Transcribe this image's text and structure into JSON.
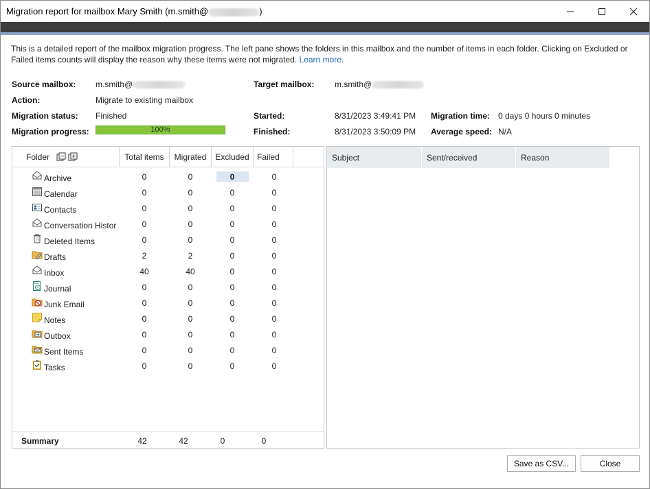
{
  "window": {
    "title_prefix": "Migration report for mailbox Mary Smith (m.smith@",
    "title_suffix": ")"
  },
  "description": {
    "text": "This is a detailed report of the mailbox migration progress. The left pane shows the folders in this mailbox and the number of items in each folder. Clicking on Excluded or Failed items counts will display the reason why these items were not migrated. ",
    "link": "Learn more."
  },
  "info": {
    "source_label": "Source mailbox:",
    "source_value": "m.smith@",
    "target_label": "Target mailbox:",
    "target_value": "m.smith@",
    "action_label": "Action:",
    "action_value": "Migrate to existing mailbox",
    "status_label": "Migration status:",
    "status_value": "Finished",
    "progress_label": "Migration progress:",
    "progress_text": "100%",
    "progress_value": 100,
    "started_label": "Started:",
    "started_value": "8/31/2023 3:49:41 PM",
    "finished_label": "Finished:",
    "finished_value": "8/31/2023 3:50:09 PM",
    "time_label": "Migration time:",
    "time_value": "0 days 0 hours 0 minutes",
    "speed_label": "Average speed:",
    "speed_value": "N/A"
  },
  "table": {
    "columns": [
      "Folder",
      "Total items",
      "Migrated",
      "Excluded",
      "Failed"
    ],
    "rows": [
      {
        "name": "Archive",
        "icon": "envelope-icon",
        "total": "0",
        "migrated": "0",
        "excluded": "0",
        "failed": "0"
      },
      {
        "name": "Calendar",
        "icon": "calendar-icon",
        "total": "0",
        "migrated": "0",
        "excluded": "0",
        "failed": "0"
      },
      {
        "name": "Contacts",
        "icon": "contact-card-icon",
        "total": "0",
        "migrated": "0",
        "excluded": "0",
        "failed": "0"
      },
      {
        "name": "Conversation Histor",
        "icon": "envelope-icon",
        "total": "0",
        "migrated": "0",
        "excluded": "0",
        "failed": "0"
      },
      {
        "name": "Deleted Items",
        "icon": "trash-icon",
        "total": "0",
        "migrated": "0",
        "excluded": "0",
        "failed": "0"
      },
      {
        "name": "Drafts",
        "icon": "drafts-folder-icon",
        "total": "2",
        "migrated": "2",
        "excluded": "0",
        "failed": "0"
      },
      {
        "name": "Inbox",
        "icon": "envelope-icon",
        "total": "40",
        "migrated": "40",
        "excluded": "0",
        "failed": "0"
      },
      {
        "name": "Journal",
        "icon": "journal-icon",
        "total": "0",
        "migrated": "0",
        "excluded": "0",
        "failed": "0"
      },
      {
        "name": "Junk Email",
        "icon": "junk-email-icon",
        "total": "0",
        "migrated": "0",
        "excluded": "0",
        "failed": "0"
      },
      {
        "name": "Notes",
        "icon": "sticky-note-icon",
        "total": "0",
        "migrated": "0",
        "excluded": "0",
        "failed": "0"
      },
      {
        "name": "Outbox",
        "icon": "outbox-icon",
        "total": "0",
        "migrated": "0",
        "excluded": "0",
        "failed": "0"
      },
      {
        "name": "Sent Items",
        "icon": "sent-folder-icon",
        "total": "0",
        "migrated": "0",
        "excluded": "0",
        "failed": "0"
      },
      {
        "name": "Tasks",
        "icon": "task-clipboard-icon",
        "total": "0",
        "migrated": "0",
        "excluded": "0",
        "failed": "0"
      }
    ],
    "summary": {
      "label": "Summary",
      "total": "42",
      "migrated": "42",
      "excluded": "0",
      "failed": "0"
    }
  },
  "details": {
    "columns": [
      "Subject",
      "Sent/received",
      "Reason"
    ]
  },
  "buttons": {
    "save_csv": "Save as CSV...",
    "close": "Close"
  },
  "colors": {
    "progress_fill": "#86c53a",
    "header_dark": "#3c3c3c",
    "accent_strip": "#8ea3c8",
    "link": "#1a5fb4",
    "selection": "#dce6f2"
  }
}
